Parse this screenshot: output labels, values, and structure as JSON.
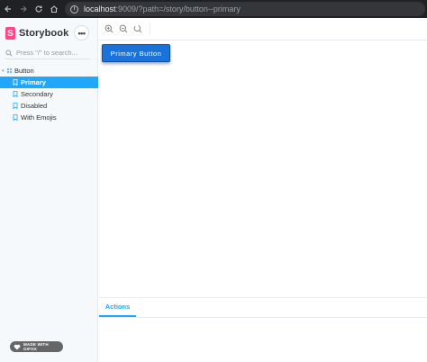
{
  "browser": {
    "url_host": "localhost",
    "url_rest": ":9009/?path=/story/button--primary"
  },
  "sidebar": {
    "brand": "Storybook",
    "logo_letter": "S",
    "menu_glyph": "•••",
    "search_placeholder": "Press \"/\" to search...",
    "group": {
      "label": "Button"
    },
    "stories": [
      {
        "label": "Primary",
        "active": true
      },
      {
        "label": "Secondary",
        "active": false
      },
      {
        "label": "Disabled",
        "active": false
      },
      {
        "label": "With Emojis",
        "active": false
      }
    ]
  },
  "preview": {
    "button_label": "Primary Button"
  },
  "panel": {
    "active_tab": "Actions"
  },
  "badge": {
    "text": "MADE WITH GIFOX"
  },
  "colors": {
    "accent": "#1ea7fd",
    "brand": "#ff4785",
    "button": "#1b73d9"
  }
}
